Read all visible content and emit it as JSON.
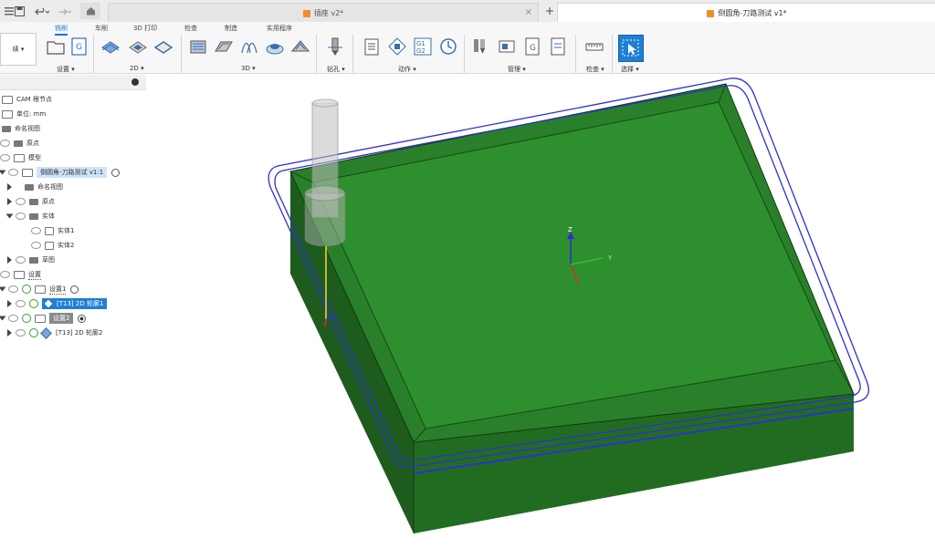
{
  "titlebar": {
    "tab1_title": "插座 v2*",
    "tab2_title": "倒圆角-刀路测试 v1*",
    "save_icon": "save-icon",
    "undo_icon": "undo-icon",
    "redo_icon": "redo-icon",
    "home_icon": "home-icon",
    "close_glyph": "×",
    "add_glyph": "+"
  },
  "ribbon": {
    "tabs": [
      "铣削",
      "车削",
      "3D 打印",
      "检查",
      "制造",
      "实用程序"
    ],
    "left_label": "续 ▾",
    "groups": [
      "设置 ▾",
      "2D ▾",
      "3D ▾",
      "钻孔 ▾",
      "动作 ▾",
      "管理 ▾",
      "检查 ▾",
      "选择 ▾"
    ],
    "g1g2": "G1\nG2"
  },
  "browser": {
    "rows": [
      {
        "label": "CAM 根节点"
      },
      {
        "label": "单位: mm"
      },
      {
        "label": "命名视图"
      },
      {
        "label": "原点"
      },
      {
        "label": "模型"
      },
      {
        "label": "倒圆角-刀路测试 v1:1"
      },
      {
        "label": "命名视图"
      },
      {
        "label": "原点"
      },
      {
        "label": "实体"
      },
      {
        "label": "实体1"
      },
      {
        "label": "实体2"
      },
      {
        "label": "草图"
      },
      {
        "label": "设置"
      },
      {
        "label": "设置1"
      },
      {
        "label": "[T13] 2D 轮廓1"
      },
      {
        "label": "设置2"
      },
      {
        "label": "[T13] 2D 轮廓2"
      }
    ]
  },
  "viewport": {
    "axis_z": "Z",
    "axis_y": "Y",
    "colors": {
      "top": "#2e8f2e",
      "side_dark": "#1e5c1e",
      "side_mid": "#237023",
      "toolpath": "#2f2fd0"
    }
  }
}
